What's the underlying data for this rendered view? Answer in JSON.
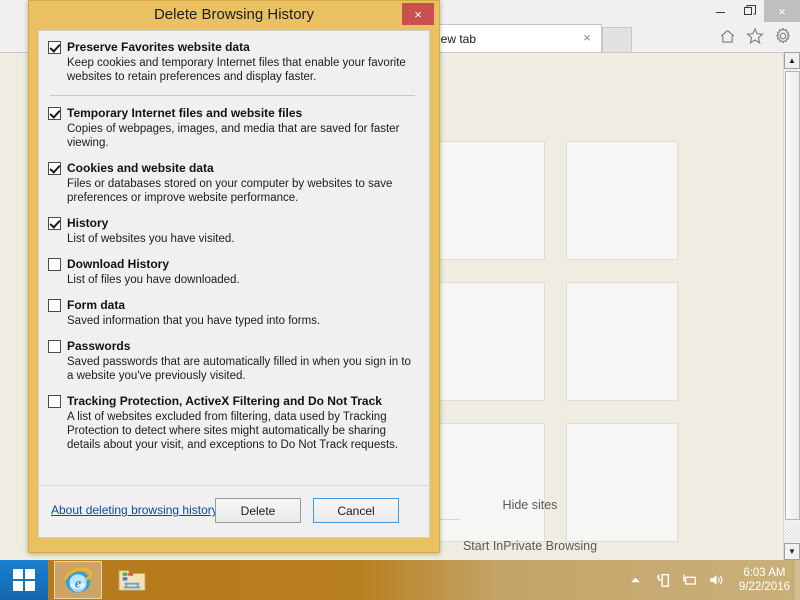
{
  "browser": {
    "window_controls": {
      "minimize": "minimize-icon",
      "restore": "restore-icon",
      "close": "×"
    },
    "tab": {
      "label": "New tab",
      "close": "×"
    },
    "new_tab_button": "new-tab-button",
    "toolbar_icons": [
      "home-icon",
      "favorites-star-icon",
      "settings-gear-icon"
    ],
    "content": {
      "hide_sites_label": "Hide sites",
      "below_text": "Start InPrivate Browsing",
      "tile_count": 4
    },
    "scrollbar": {
      "up_arrow": "▲",
      "down_arrow": "▼"
    }
  },
  "dialog": {
    "title": "Delete Browsing History",
    "close_label": "×",
    "accent_color": "#e9c163",
    "close_color": "#c9504f",
    "options": [
      {
        "title": "Preserve Favorites website data",
        "description": "Keep cookies and temporary Internet files that enable your favorite websites to retain preferences and display faster.",
        "checked": true,
        "separator_after": true
      },
      {
        "title": "Temporary Internet files and website files",
        "description": "Copies of webpages, images, and media that are saved for faster viewing.",
        "checked": true,
        "separator_after": false
      },
      {
        "title": "Cookies and website data",
        "description": "Files or databases stored on your computer by websites to save preferences or improve website performance.",
        "checked": true,
        "separator_after": false
      },
      {
        "title": "History",
        "description": "List of websites you have visited.",
        "checked": true,
        "separator_after": false
      },
      {
        "title": "Download History",
        "description": "List of files you have downloaded.",
        "checked": false,
        "separator_after": false
      },
      {
        "title": "Form data",
        "description": "Saved information that you have typed into forms.",
        "checked": false,
        "separator_after": false
      },
      {
        "title": "Passwords",
        "description": "Saved passwords that are automatically filled in when you sign in to a website you've previously visited.",
        "checked": false,
        "separator_after": false
      },
      {
        "title": "Tracking Protection, ActiveX Filtering and Do Not Track",
        "description": "A list of websites excluded from filtering, data used by Tracking Protection to detect where sites might automatically be sharing details about your visit, and exceptions to Do Not Track requests.",
        "checked": false,
        "separator_after": false
      }
    ],
    "footer": {
      "help_link": "About deleting browsing history",
      "delete_label": "Delete",
      "cancel_label": "Cancel"
    }
  },
  "taskbar": {
    "start_label": "start-button",
    "items": [
      {
        "name": "internet-explorer",
        "active": true
      },
      {
        "name": "file-explorer",
        "active": false
      }
    ],
    "tray_icons": [
      "show-hidden-icons",
      "power-icon",
      "network-icon",
      "volume-icon"
    ],
    "clock": {
      "time": "6:03 AM",
      "date": "9/22/2016"
    }
  }
}
